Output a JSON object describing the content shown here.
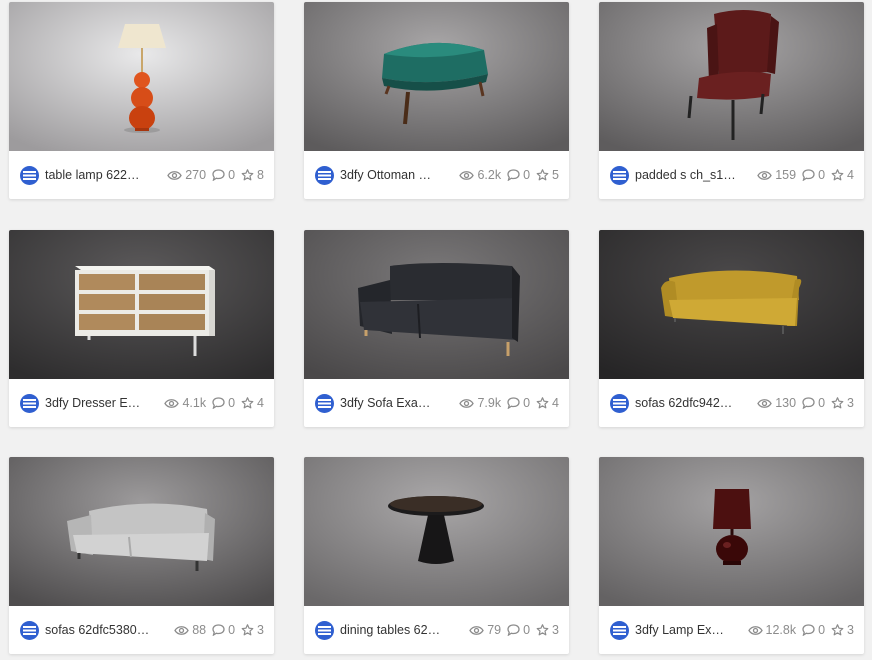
{
  "models": [
    {
      "title": "table lamp 622…",
      "views": "270",
      "comments": "0",
      "likes": "8",
      "thumb": "table-lamp"
    },
    {
      "title": "3dfy Ottoman …",
      "views": "6.2k",
      "comments": "0",
      "likes": "5",
      "thumb": "ottoman"
    },
    {
      "title": "padded s ch_s1…",
      "views": "159",
      "comments": "0",
      "likes": "4",
      "thumb": "chair"
    },
    {
      "title": "3dfy Dresser E…",
      "views": "4.1k",
      "comments": "0",
      "likes": "4",
      "thumb": "dresser"
    },
    {
      "title": "3dfy Sofa Exa…",
      "views": "7.9k",
      "comments": "0",
      "likes": "4",
      "thumb": "black-sofa"
    },
    {
      "title": "sofas 62dfc942…",
      "views": "130",
      "comments": "0",
      "likes": "3",
      "thumb": "yellow-sofa"
    },
    {
      "title": "sofas 62dfc5380…",
      "views": "88",
      "comments": "0",
      "likes": "3",
      "thumb": "grey-sofa"
    },
    {
      "title": "dining tables 62…",
      "views": "79",
      "comments": "0",
      "likes": "3",
      "thumb": "dining-table"
    },
    {
      "title": "3dfy Lamp Ex…",
      "views": "12.8k",
      "comments": "0",
      "likes": "3",
      "thumb": "red-lamp"
    }
  ],
  "icons": {
    "author": "3dfy-logo-icon",
    "views": "eye-icon",
    "comments": "comment-icon",
    "likes": "star-icon"
  },
  "colors": {
    "logo_blue": "#2f5fd0",
    "stat_grey": "#8c8c8c",
    "title": "#333333"
  }
}
